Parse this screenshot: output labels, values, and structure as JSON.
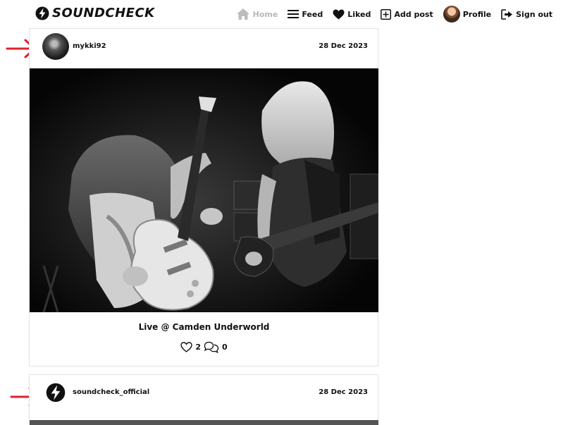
{
  "brand": {
    "name": "SOUNDCHECK",
    "logo_icon": "bolt-logo-icon"
  },
  "nav": {
    "home": "Home",
    "feed": "Feed",
    "liked": "Liked",
    "add_post": "Add post",
    "profile": "Profile",
    "sign_out": "Sign out",
    "active": "Home"
  },
  "posts": [
    {
      "username": "mykki92",
      "date": "28 Dec 2023",
      "caption": "Live @ Camden Underworld",
      "likes": "2",
      "comments": "0"
    },
    {
      "username": "soundcheck_official",
      "date": "28 Dec 2023"
    }
  ],
  "colors": {
    "accent_arrow": "#e0202a",
    "active_nav": "#b9b9b9",
    "text": "#111111"
  }
}
